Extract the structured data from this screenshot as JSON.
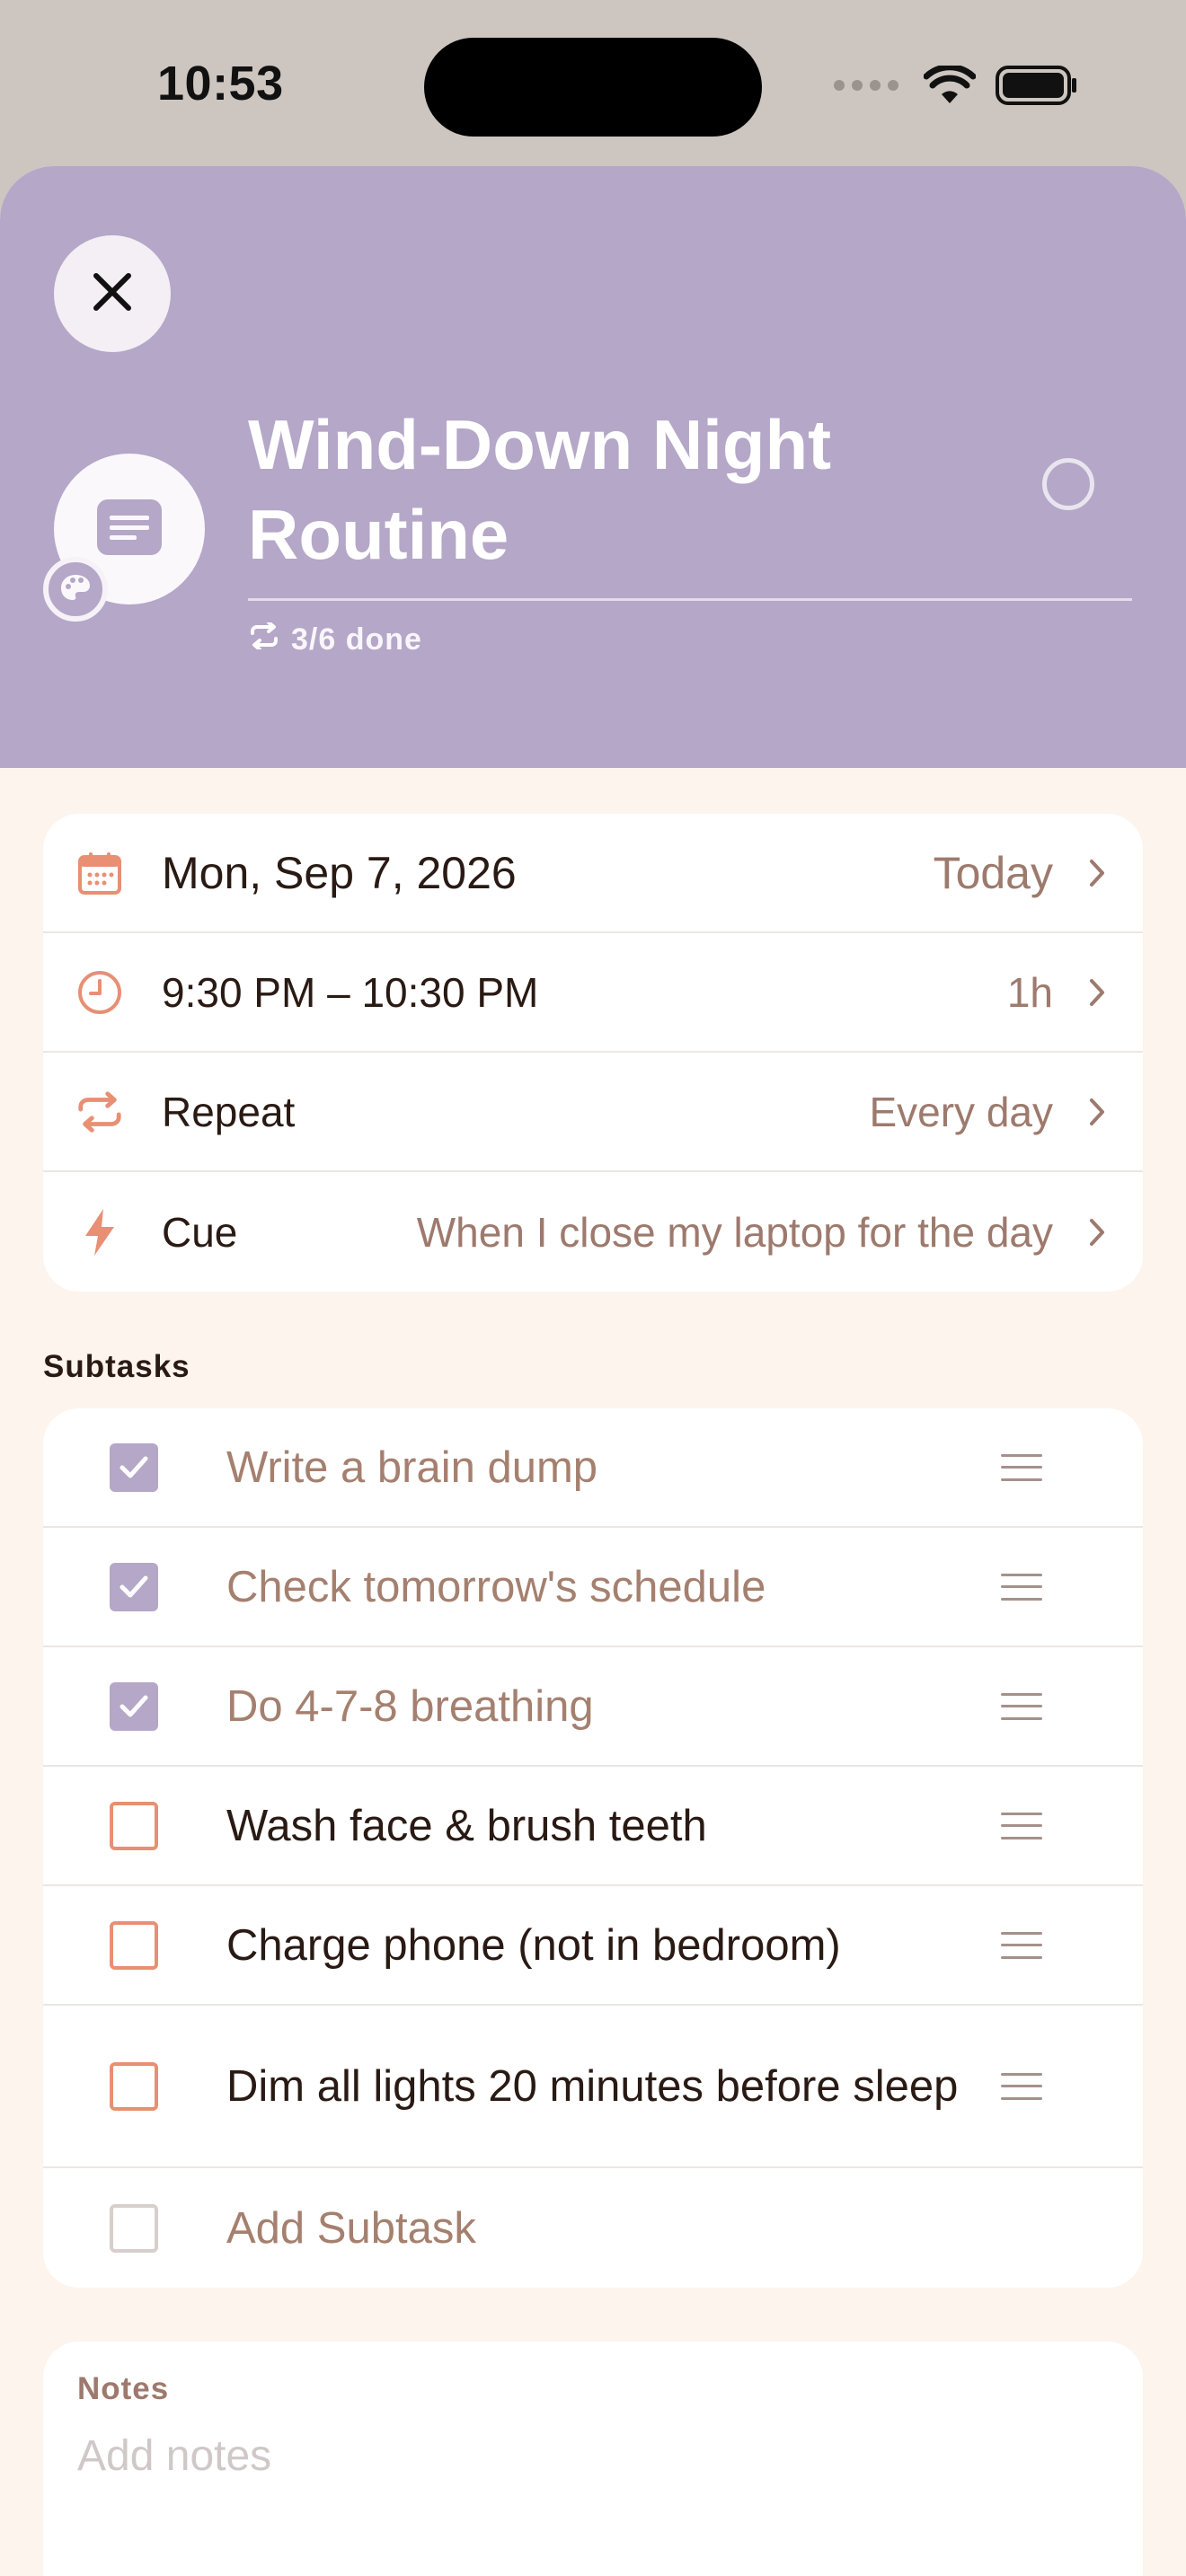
{
  "status_bar": {
    "time": "10:53"
  },
  "header": {
    "title": "Wind-Down Night Routine",
    "progress": "3/6 done",
    "color": "#b5a7c8"
  },
  "details": {
    "date": {
      "label": "Mon, Sep 7, 2026",
      "value": "Today",
      "icon": "calendar-icon"
    },
    "time": {
      "label": "9:30 PM – 10:30 PM",
      "value": "1h",
      "icon": "clock-icon"
    },
    "repeat": {
      "label": "Repeat",
      "value": "Every day",
      "icon": "repeat-icon"
    },
    "cue": {
      "label": "Cue",
      "value": "When I close my laptop for the day",
      "icon": "lightning-icon"
    }
  },
  "subtasks": {
    "section_title": "Subtasks",
    "items": [
      {
        "label": "Write a brain dump",
        "done": true
      },
      {
        "label": "Check tomorrow's schedule",
        "done": true
      },
      {
        "label": "Do 4-7-8 breathing",
        "done": true
      },
      {
        "label": "Wash face & brush teeth",
        "done": false
      },
      {
        "label": "Charge phone (not in bedroom)",
        "done": false
      },
      {
        "label": "Dim all lights 20 minutes before sleep",
        "done": false
      }
    ],
    "add_label": "Add Subtask"
  },
  "notes": {
    "title": "Notes",
    "placeholder": "Add notes"
  },
  "colors": {
    "accent": "#e88f74",
    "lavender": "#b5a7c8",
    "background": "#fdf4ee",
    "muted_text": "#9d7a6d"
  }
}
